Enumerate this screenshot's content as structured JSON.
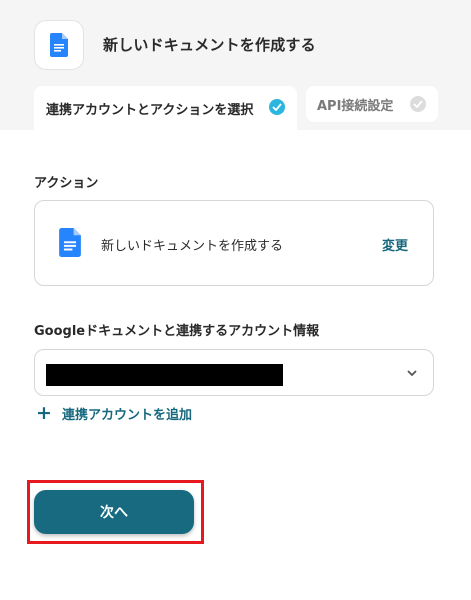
{
  "header": {
    "title": "新しいドキュメントを作成する",
    "app_icon": "google-docs-icon"
  },
  "tabs": [
    {
      "label": "連携アカウントとアクションを選択",
      "status": "completed"
    },
    {
      "label": "API接続設定",
      "status": "pending"
    }
  ],
  "action_section": {
    "label": "アクション",
    "action_name": "新しいドキュメントを作成する",
    "change_label": "変更",
    "icon": "google-docs-icon"
  },
  "account_section": {
    "label": "Googleドキュメントと連携するアカウント情報",
    "add_account_label": "連携アカウントを追加"
  },
  "footer": {
    "next_label": "次へ"
  },
  "colors": {
    "accent": "#176a80",
    "check_active": "#2bb6dd",
    "highlight": "#e5191e"
  }
}
